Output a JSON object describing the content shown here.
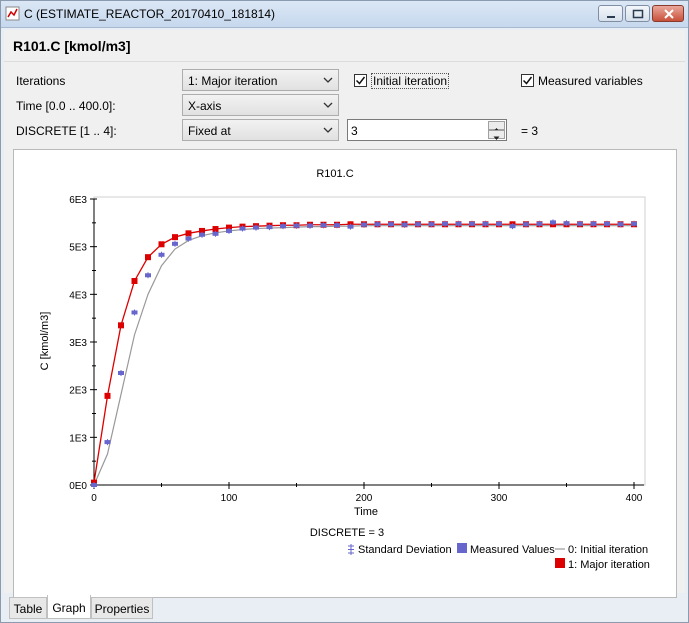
{
  "window": {
    "title": "C  (ESTIMATE_REACTOR_20170410_181814)"
  },
  "header": {
    "title": "R101.C [kmol/m3]"
  },
  "controls": {
    "iterations_label": "Iterations",
    "iterations_value": "1: Major iteration",
    "time_label": "Time [0.0 .. 400.0]:",
    "time_value": "X-axis",
    "discrete_label": "DISCRETE [1 .. 4]:",
    "discrete_value": "Fixed at",
    "discrete_spin_value": "3",
    "discrete_equals": "= 3",
    "initial_iteration_label": "Initial iteration",
    "initial_iteration_checked": true,
    "measured_variables_label": "Measured variables",
    "measured_variables_checked": true
  },
  "tabs": [
    {
      "label": "Table",
      "active": false
    },
    {
      "label": "Graph",
      "active": true
    },
    {
      "label": "Properties",
      "active": false
    }
  ],
  "chart_data": {
    "type": "line",
    "title": "R101.C",
    "xlabel": "Time",
    "ylabel": "C [kmol/m3]",
    "xlim": [
      0,
      400
    ],
    "ylim": [
      0,
      6000
    ],
    "xticks": [
      "0",
      "100",
      "200",
      "300",
      "400"
    ],
    "yticks": [
      "0E0",
      "1E3",
      "2E3",
      "3E3",
      "4E3",
      "5E3",
      "6E3"
    ],
    "subtitle": "DISCRETE = 3",
    "legend": [
      "Standard Deviation",
      "Measured Values",
      "0: Initial iteration",
      "1: Major iteration"
    ],
    "colors": {
      "measured": "#6666cc",
      "initial": "#999999",
      "major": "#dd0000"
    },
    "series": [
      {
        "name": "Measured Values",
        "x": [
          0,
          10,
          20,
          30,
          40,
          50,
          60,
          70,
          80,
          90,
          100,
          110,
          120,
          130,
          140,
          150,
          160,
          170,
          180,
          190,
          200,
          210,
          220,
          230,
          240,
          250,
          260,
          270,
          280,
          290,
          300,
          310,
          320,
          330,
          340,
          350,
          360,
          370,
          380,
          390,
          400
        ],
        "y": [
          0,
          900,
          2350,
          3620,
          4400,
          4830,
          5060,
          5170,
          5250,
          5270,
          5330,
          5380,
          5400,
          5410,
          5430,
          5440,
          5440,
          5450,
          5450,
          5420,
          5460,
          5470,
          5470,
          5460,
          5470,
          5470,
          5480,
          5480,
          5480,
          5480,
          5480,
          5430,
          5470,
          5480,
          5510,
          5490,
          5480,
          5480,
          5480,
          5470,
          5480
        ]
      },
      {
        "name": "0: Initial iteration",
        "x": [
          0,
          10,
          20,
          30,
          40,
          50,
          60,
          70,
          80,
          90,
          100,
          110,
          120,
          130,
          140,
          150,
          160,
          170,
          180,
          190,
          200,
          210,
          220,
          230,
          240,
          250,
          260,
          270,
          280,
          290,
          300,
          310,
          320,
          330,
          340,
          350,
          360,
          370,
          380,
          390,
          400
        ],
        "y": [
          0,
          650,
          1900,
          3150,
          4000,
          4600,
          4950,
          5130,
          5230,
          5290,
          5330,
          5360,
          5380,
          5390,
          5400,
          5410,
          5420,
          5420,
          5430,
          5430,
          5440,
          5440,
          5440,
          5440,
          5440,
          5440,
          5440,
          5440,
          5440,
          5440,
          5440,
          5440,
          5440,
          5440,
          5440,
          5440,
          5440,
          5440,
          5440,
          5440,
          5440
        ]
      },
      {
        "name": "1: Major iteration",
        "x": [
          0,
          10,
          20,
          30,
          40,
          50,
          60,
          70,
          80,
          90,
          100,
          110,
          120,
          130,
          140,
          150,
          160,
          170,
          180,
          190,
          200,
          210,
          220,
          230,
          240,
          250,
          260,
          270,
          280,
          290,
          300,
          310,
          320,
          330,
          340,
          350,
          360,
          370,
          380,
          390,
          400
        ],
        "y": [
          50,
          1870,
          3350,
          4280,
          4780,
          5050,
          5200,
          5280,
          5330,
          5370,
          5400,
          5420,
          5430,
          5440,
          5450,
          5450,
          5460,
          5460,
          5460,
          5470,
          5470,
          5470,
          5470,
          5470,
          5470,
          5470,
          5470,
          5470,
          5470,
          5470,
          5470,
          5470,
          5470,
          5470,
          5470,
          5470,
          5470,
          5470,
          5470,
          5470,
          5470
        ]
      }
    ]
  }
}
